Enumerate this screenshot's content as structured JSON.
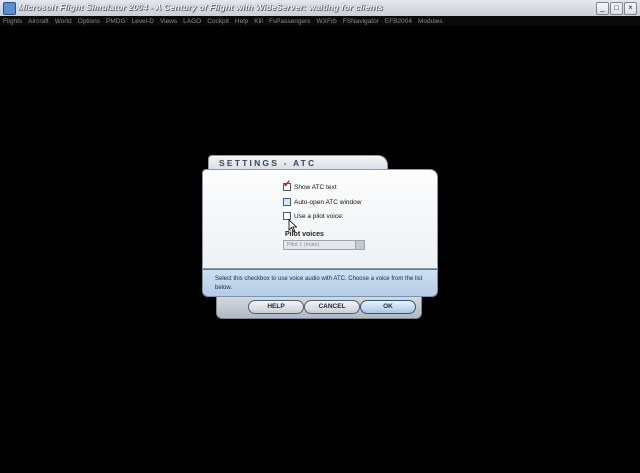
{
  "window": {
    "title": "Microsoft Flight Simulator 2004 - A Century of Flight with WideServer: waiting for clients",
    "minimize_glyph": "_",
    "maximize_glyph": "□",
    "close_glyph": "×"
  },
  "menu": [
    "Flights",
    "Aircraft",
    "World",
    "Options",
    "PMDG",
    "Level-D",
    "Views",
    "LAGO",
    "Cockpit",
    "Help",
    "Kill",
    "FsPassengers",
    "WXFrb",
    "FSNavigator",
    "EFB2004",
    "Modules"
  ],
  "dialog": {
    "tab_title": "SETTINGS - ATC",
    "options": {
      "show_atc_text": {
        "label": "Show ATC text",
        "checked": true
      },
      "auto_open_atc": {
        "label": "Auto-open ATC window",
        "checked": false
      },
      "use_pilot_voice": {
        "label": "Use a pilot voice:",
        "checked": false
      }
    },
    "pilot_voices_label": "Pilot voices",
    "pilot_voice_selected": "Pilot 1 (male)",
    "help_text": "Select this checkbox to use voice audio with ATC. Choose a voice from the list below.",
    "buttons": {
      "help": "HELP",
      "cancel": "CANCEL",
      "ok": "OK"
    }
  },
  "colors": {
    "check": "#c01818",
    "help_bg": "#c2d6ec"
  }
}
